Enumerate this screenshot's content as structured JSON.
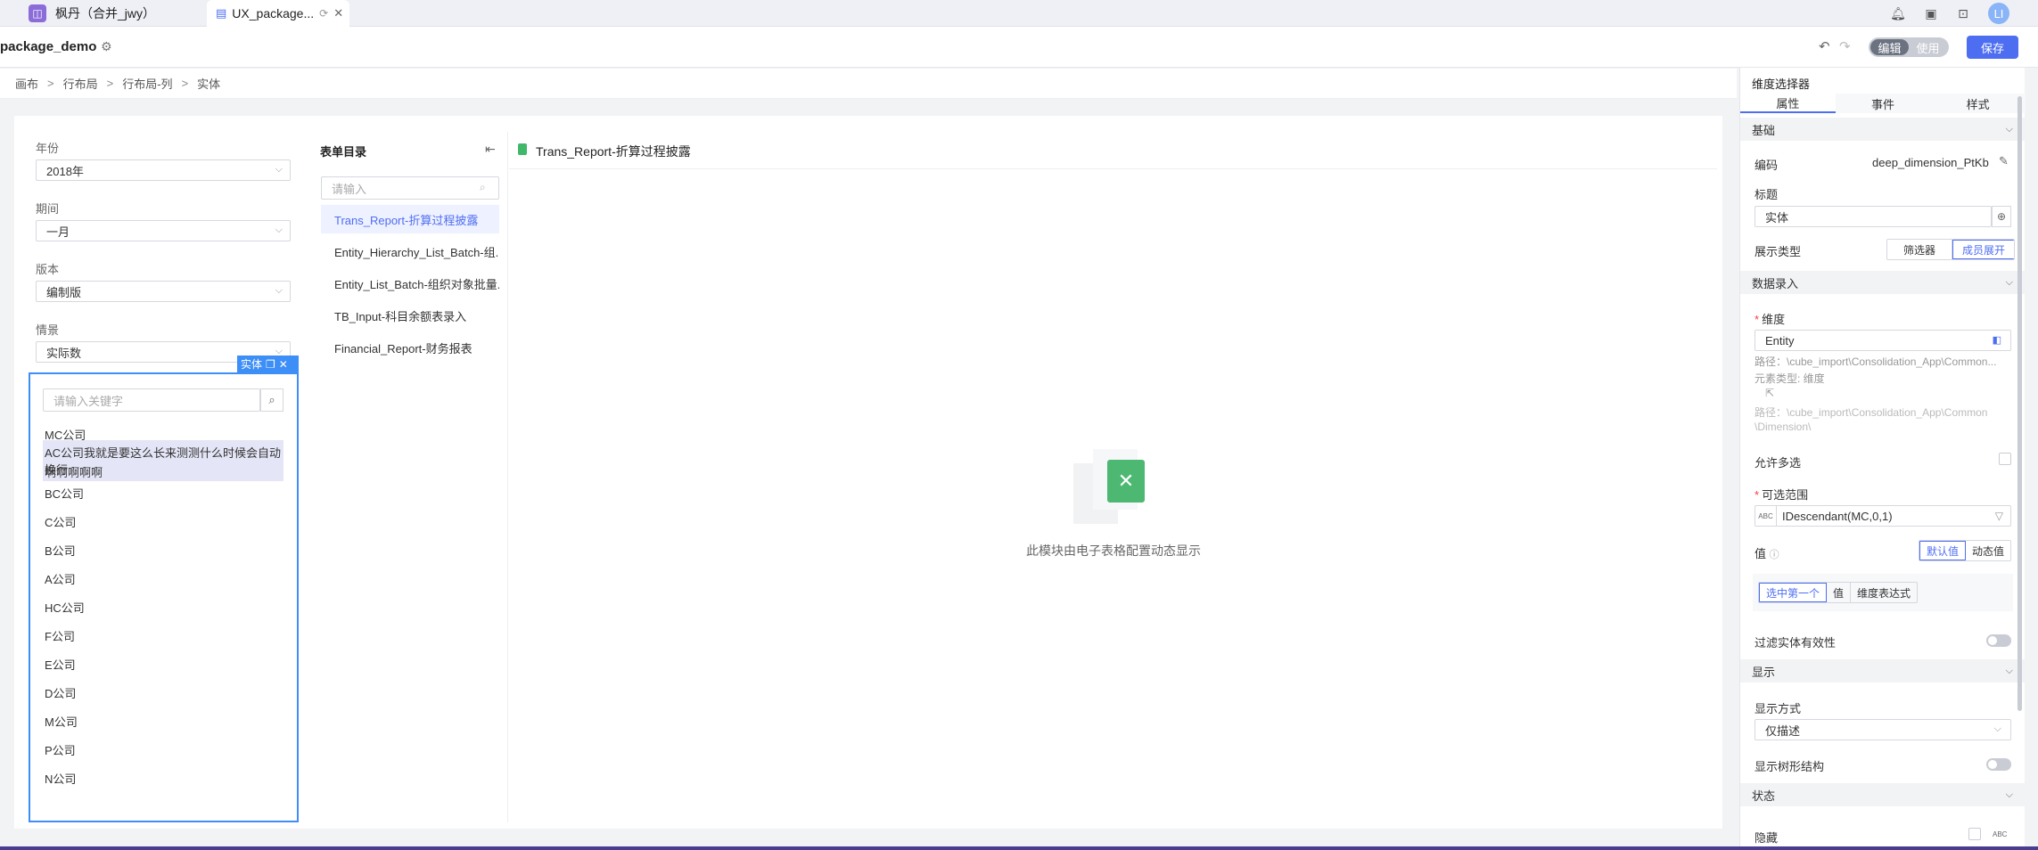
{
  "tabs": [
    {
      "label": "枫丹（合并_jwy）",
      "icon": "workspace-icon"
    },
    {
      "label": "UX_package...",
      "icon": "document-icon"
    }
  ],
  "header": {
    "title": "package_demo",
    "mode_edit": "编辑",
    "mode_use": "使用",
    "save": "保存",
    "avatar": "LI"
  },
  "breadcrumb": [
    "画布",
    "行布局",
    "行布局-列",
    "实体"
  ],
  "filters": [
    {
      "label": "年份",
      "value": "2018年"
    },
    {
      "label": "期间",
      "value": "一月"
    },
    {
      "label": "版本",
      "value": "编制版"
    },
    {
      "label": "情景",
      "value": "实际数"
    }
  ],
  "entity_popup": {
    "tag": "实体",
    "search_placeholder": "请输入关键字",
    "items": [
      "MC公司",
      "AC公司我就是要这么长来测测什么时候会自动换行",
      "啊啊啊啊啊",
      "BC公司",
      "C公司",
      "B公司",
      "A公司",
      "HC公司",
      "F公司",
      "E公司",
      "D公司",
      "M公司",
      "P公司",
      "N公司"
    ]
  },
  "form_list": {
    "title": "表单目录",
    "search_placeholder": "请输入",
    "items": [
      "Trans_Report-折算过程披露",
      "Entity_Hierarchy_List_Batch-组...",
      "Entity_List_Batch-组织对象批量...",
      "TB_Input-科目余额表录入",
      "Financial_Report-财务报表"
    ]
  },
  "report": {
    "title": "Trans_Report-折算过程披露",
    "empty_text": "此模块由电子表格配置动态显示"
  },
  "panel": {
    "title": "维度选择器",
    "tabs": [
      "属性",
      "事件",
      "样式"
    ],
    "basic": {
      "section": "基础",
      "code_label": "编码",
      "code_value": "deep_dimension_PtKb",
      "title_label": "标题",
      "title_value": "实体",
      "display_type_label": "展示类型",
      "display_options": [
        "筛选器",
        "成员展开"
      ]
    },
    "data_entry": {
      "section": "数据录入",
      "dim_label": "维度",
      "dim_value": "Entity",
      "path1": "路径：\\cube_import\\Consolidation_App\\Common...",
      "elem_type": "元素类型: 维度",
      "path2": "路径：\\cube_import\\Consolidation_App\\Common",
      "path2b": "\\Dimension\\",
      "multi_label": "允许多选",
      "range_label": "可选范围",
      "range_prefix": "ABC",
      "range_value": "IDescendant(MC,0,1)",
      "value_label": "值",
      "value_options": [
        "默认值",
        "动态值"
      ],
      "select_options": [
        "选中第一个",
        "值",
        "维度表达式"
      ],
      "filter_label": "过滤实体有效性"
    },
    "display": {
      "section": "显示",
      "mode_label": "显示方式",
      "mode_value": "仅描述",
      "tree_label": "显示树形结构"
    },
    "state": {
      "section": "状态",
      "hidden_label": "隐藏",
      "hidden_suffix": "ABC"
    }
  }
}
